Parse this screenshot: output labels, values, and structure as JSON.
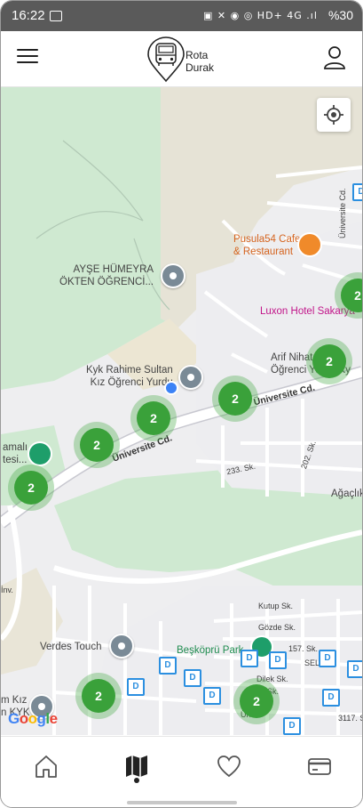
{
  "status_bar": {
    "time": "16:22",
    "right_icons": "▣ ✕ ◉ ◎ HD+ 4G .ıl",
    "battery": "%30"
  },
  "header": {
    "logo_line1": "Rota",
    "logo_line2": "Durak"
  },
  "map": {
    "pois": [
      {
        "name": "AYŞE HÜMEYRA\nÖKTEN ÖĞRENCİ...",
        "kind": "grey"
      },
      {
        "name": "Pusula54 Cafe\n& Restaurant",
        "kind": "orange"
      },
      {
        "name": "Luxon Hotel Sakarya",
        "kind": "pink"
      },
      {
        "name": "Arif Nihat Erken\nÖğrenci Yurdu Ky",
        "kind": "grey"
      },
      {
        "name": "Kyk Rahime Sultan\nKız Öğrenci Yurdu",
        "kind": "grey"
      },
      {
        "name": "Ağaçlık",
        "kind": "grey"
      },
      {
        "name": "amalı\ntesi...",
        "kind": "grey"
      },
      {
        "name": "Verdes Touch",
        "kind": "grey"
      },
      {
        "name": "Beşköprü Park",
        "kind": "green"
      },
      {
        "name": "m Kız\nn KYK",
        "kind": "grey"
      }
    ],
    "streets": {
      "universite_cd": "Üniversite Cd.",
      "universite_cd_2": "Üniversite Cd.",
      "s233": "233. Sk.",
      "s202": "202. Sk.",
      "kutup": "Kutup Sk.",
      "gozde": "Gözde Sk.",
      "s157": "157. Sk.",
      "dilek": "Dilek Sk.",
      "s3117": "3117. Sk.",
      "universite_vertical": "Üniversite Cd.",
      "inv": "İnv.",
      "sel": "SEL",
      "sk_partial": "Sk.",
      "un": "Ün"
    },
    "clusters": [
      {
        "count": "2"
      },
      {
        "count": "2"
      },
      {
        "count": "2"
      },
      {
        "count": "2"
      },
      {
        "count": "2"
      },
      {
        "count": "2"
      },
      {
        "count": "2"
      },
      {
        "count": "2"
      }
    ],
    "stop_letter": "D",
    "attribution": "Google"
  },
  "nav": {
    "items": [
      "home-icon",
      "map-icon",
      "heart-icon",
      "card-icon"
    ],
    "active": "map-icon"
  },
  "colors": {
    "cluster": "#3aa13a",
    "stop": "#2b8fe0",
    "park": "#c9e8cc",
    "road": "#ffffff"
  }
}
